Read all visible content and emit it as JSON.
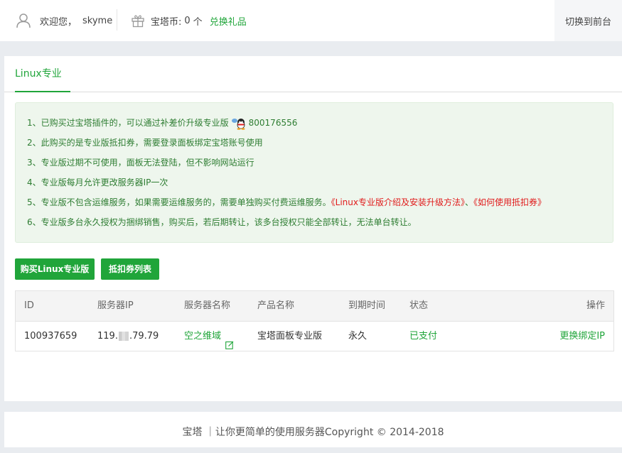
{
  "header": {
    "welcome": "欢迎您，",
    "username": "skyme",
    "coin_label": "宝塔币:",
    "coin_value": "0",
    "coin_unit": "个",
    "exchange_link": "兑换礼品",
    "switch_front": "切换到前台",
    "user_icon": "user-icon",
    "gift_icon": "gift-icon"
  },
  "tabs": [
    {
      "label": "Linux专业版",
      "active": true
    }
  ],
  "notice": {
    "line1_text": "1、已购买过宝塔插件的，可以通过补差价升级专业版",
    "line1_qq": "800176556",
    "line2": "2、此购买的是专业版抵扣券，需要登录面板绑定宝塔账号使用",
    "line3": "3、专业版过期不可使用，面板无法登陆，但不影响网站运行",
    "line4": "4、专业版每月允许更改服务器IP一次",
    "line5_text": "5、专业版不包含运维服务，如果需要运维服务的，需要单独购买付费运维服务。",
    "line5_link1": "《Linux专业版介绍及安装升级方法》",
    "line5_sep": "、",
    "line5_link2": "《如何使用抵扣券》",
    "line6": "6、专业版多台永久授权为捆绑销售，购买后，若后期转让，该多台授权只能全部转让，无法单台转让。"
  },
  "buttons": {
    "buy": "购买Linux专业版",
    "voucher_list": "抵扣券列表"
  },
  "table": {
    "headers": [
      "ID",
      "服务器IP",
      "服务器名称",
      "产品名称",
      "到期时间",
      "状态",
      "操作"
    ],
    "rows": [
      {
        "id": "100937659",
        "ip_prefix": "119.",
        "ip_suffix": ".79.79",
        "server_name": "空之维域",
        "product": "宝塔面板专业版",
        "expire": "永久",
        "status": "已支付",
        "action": "更换绑定IP"
      }
    ]
  },
  "footer": {
    "text": "宝塔 ｜让你更简单的使用服务器Copyright © 2014-2018"
  },
  "colors": {
    "accent": "#20a53a",
    "notice_bg": "#eef6ed",
    "notice_text": "#2e7d32",
    "link_red": "#e01b1b"
  }
}
